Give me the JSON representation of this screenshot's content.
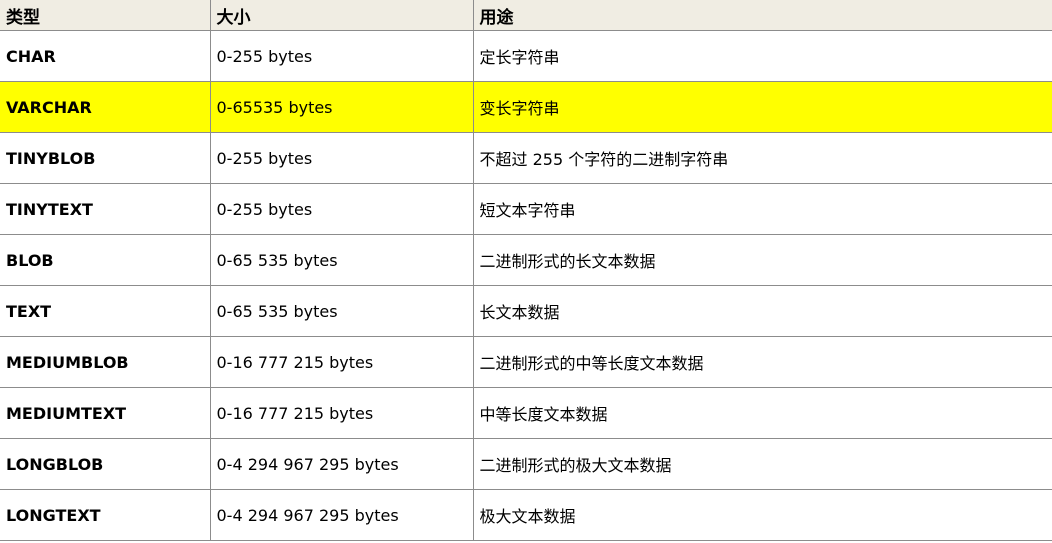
{
  "table": {
    "columns": [
      "类型",
      "大小",
      "用途"
    ],
    "highlight_color": "#ffff00",
    "highlighted_row": 1,
    "rows": [
      {
        "type": "CHAR",
        "size": "0-255 bytes",
        "usage": "定长字符串"
      },
      {
        "type": "VARCHAR",
        "size": "0-65535 bytes",
        "usage": "变长字符串"
      },
      {
        "type": "TINYBLOB",
        "size": "0-255 bytes",
        "usage": "不超过 255 个字符的二进制字符串"
      },
      {
        "type": "TINYTEXT",
        "size": "0-255 bytes",
        "usage": "短文本字符串"
      },
      {
        "type": "BLOB",
        "size": "0-65 535 bytes",
        "usage": "二进制形式的长文本数据"
      },
      {
        "type": "TEXT",
        "size": "0-65 535 bytes",
        "usage": "长文本数据"
      },
      {
        "type": "MEDIUMBLOB",
        "size": "0-16 777 215 bytes",
        "usage": "二进制形式的中等长度文本数据"
      },
      {
        "type": "MEDIUMTEXT",
        "size": "0-16 777 215 bytes",
        "usage": "中等长度文本数据"
      },
      {
        "type": "LONGBLOB",
        "size": "0-4 294 967 295 bytes",
        "usage": "二进制形式的极大文本数据"
      },
      {
        "type": "LONGTEXT",
        "size": "0-4 294 967 295 bytes",
        "usage": "极大文本数据"
      }
    ]
  }
}
